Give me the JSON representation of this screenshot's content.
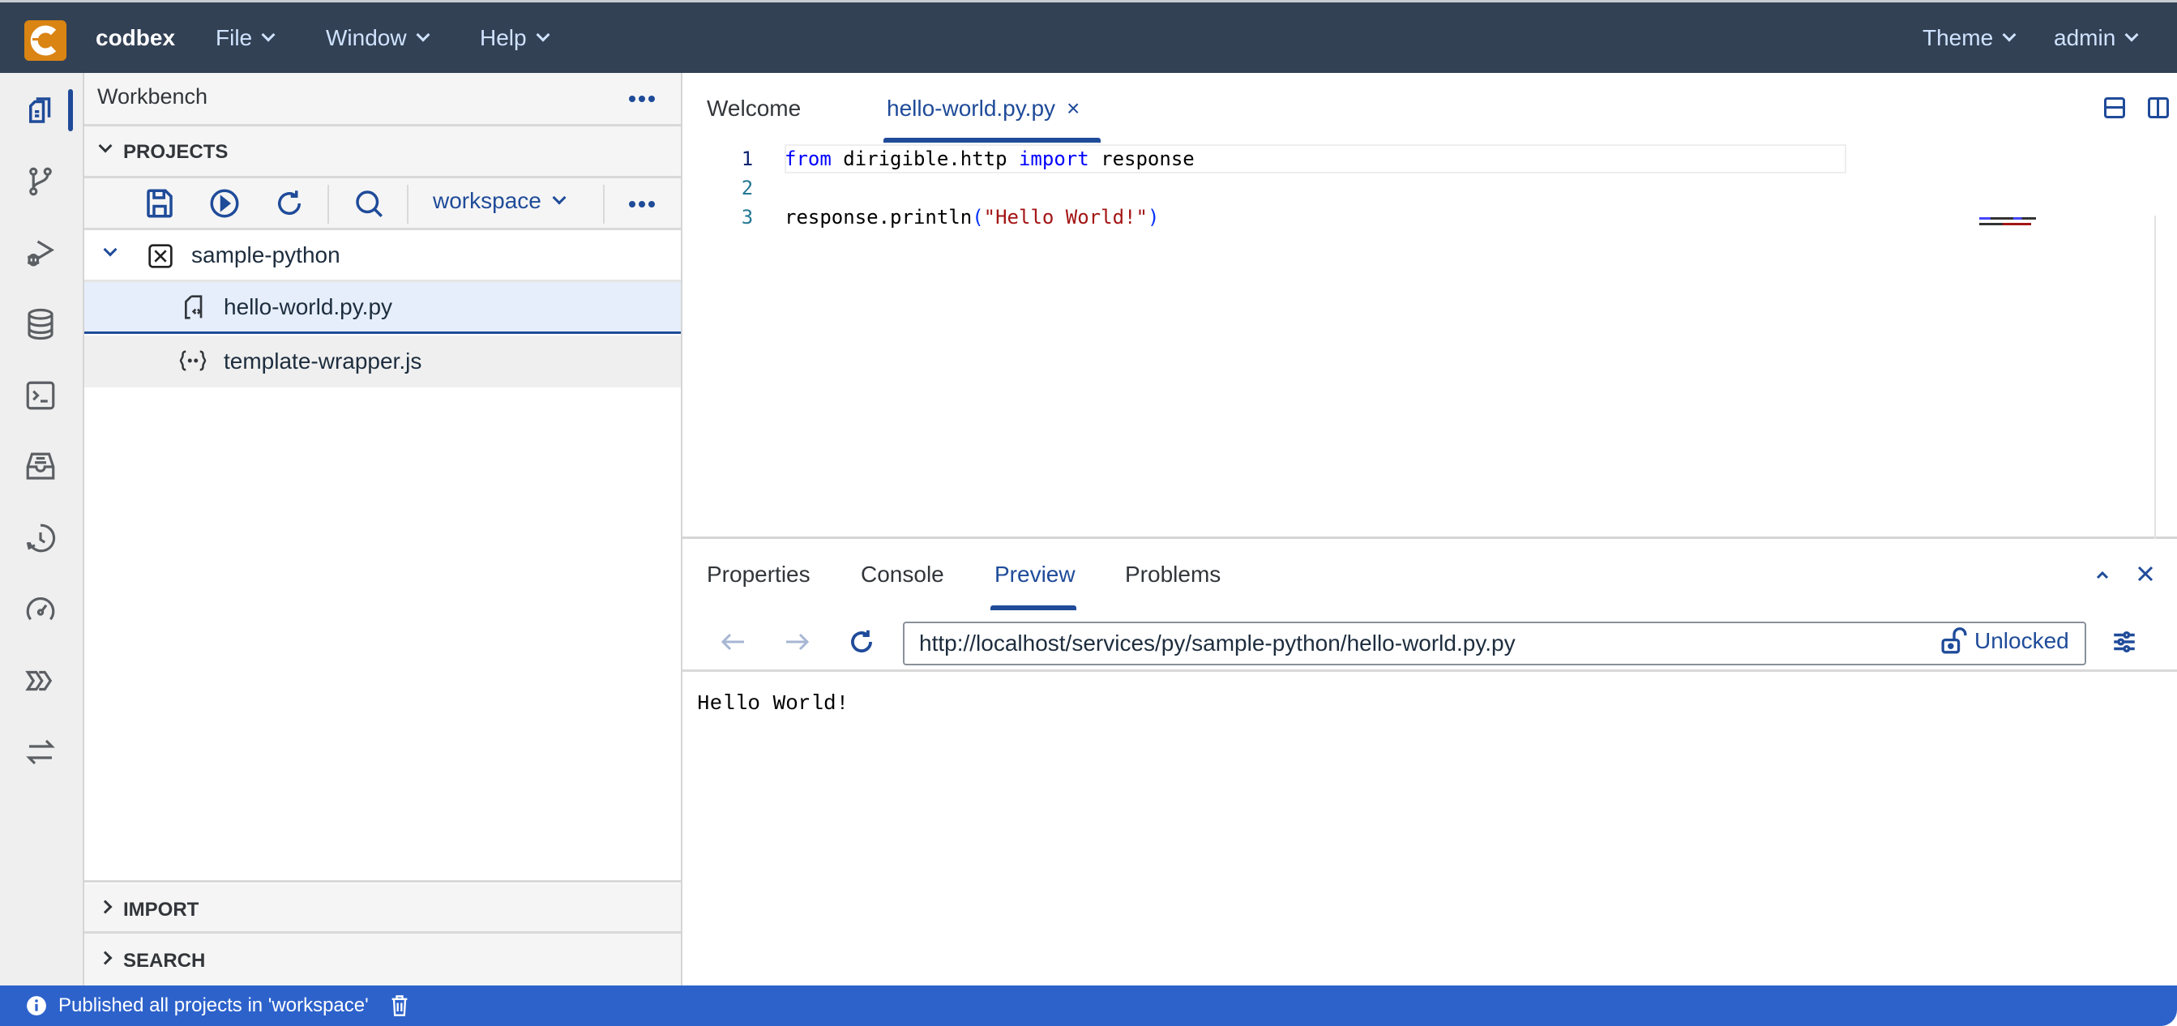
{
  "header": {
    "brand": "codbex",
    "menus": [
      {
        "label": "File"
      },
      {
        "label": "Window"
      },
      {
        "label": "Help"
      }
    ],
    "right_menus": [
      {
        "label": "Theme"
      },
      {
        "label": "admin"
      }
    ]
  },
  "activity_bar": {
    "items": [
      {
        "icon": "workbench-files-icon",
        "active": true
      },
      {
        "icon": "git-branch-icon"
      },
      {
        "icon": "debug-icon"
      },
      {
        "icon": "database-icon"
      },
      {
        "icon": "terminal-icon"
      },
      {
        "icon": "inbox-tray-icon"
      },
      {
        "icon": "history-icon"
      },
      {
        "icon": "speedometer-icon"
      },
      {
        "icon": "process-chevrons-icon"
      },
      {
        "icon": "transfer-arrows-icon"
      }
    ]
  },
  "sidebar": {
    "title": "Workbench",
    "projects_section": "PROJECTS",
    "toolbar": {
      "workspace": "workspace",
      "buttons": [
        "save-icon",
        "publish-icon",
        "refresh-icon",
        "search-icon"
      ]
    },
    "tree": {
      "project": "sample-python",
      "files": [
        {
          "name": "hello-world.py.py",
          "selected": true
        },
        {
          "name": "template-wrapper.js",
          "selected": false
        }
      ]
    },
    "import_section": "IMPORT",
    "search_section": "SEARCH"
  },
  "editor": {
    "tabs": [
      {
        "label": "Welcome",
        "active": false
      },
      {
        "label": "hello-world.py.py",
        "active": true,
        "close": "×"
      }
    ],
    "lines": [
      {
        "num": "1",
        "tokens": [
          {
            "t": "from",
            "c": "kw"
          },
          {
            "t": " dirigible.http ",
            "c": ""
          },
          {
            "t": "import",
            "c": "kw"
          },
          {
            "t": " response",
            "c": ""
          }
        ]
      },
      {
        "num": "2",
        "tokens": []
      },
      {
        "num": "3",
        "tokens": [
          {
            "t": "response.println",
            "c": ""
          },
          {
            "t": "(",
            "c": "pn"
          },
          {
            "t": "\"Hello World!\"",
            "c": "str"
          },
          {
            "t": ")",
            "c": "pn"
          }
        ]
      }
    ]
  },
  "panel": {
    "tabs": [
      {
        "label": "Properties"
      },
      {
        "label": "Console"
      },
      {
        "label": "Preview",
        "active": true
      },
      {
        "label": "Problems"
      }
    ],
    "preview": {
      "url": "http://localhost/services/py/sample-python/hello-world.py.py",
      "lock_label": "Unlocked",
      "output": "Hello World!"
    }
  },
  "status": {
    "message": "Published all projects in 'workspace'"
  },
  "colors": {
    "header_bg": "#334155",
    "accent": "#1f4b99",
    "logo": "#d98413",
    "status_bg": "#2d62cb"
  }
}
